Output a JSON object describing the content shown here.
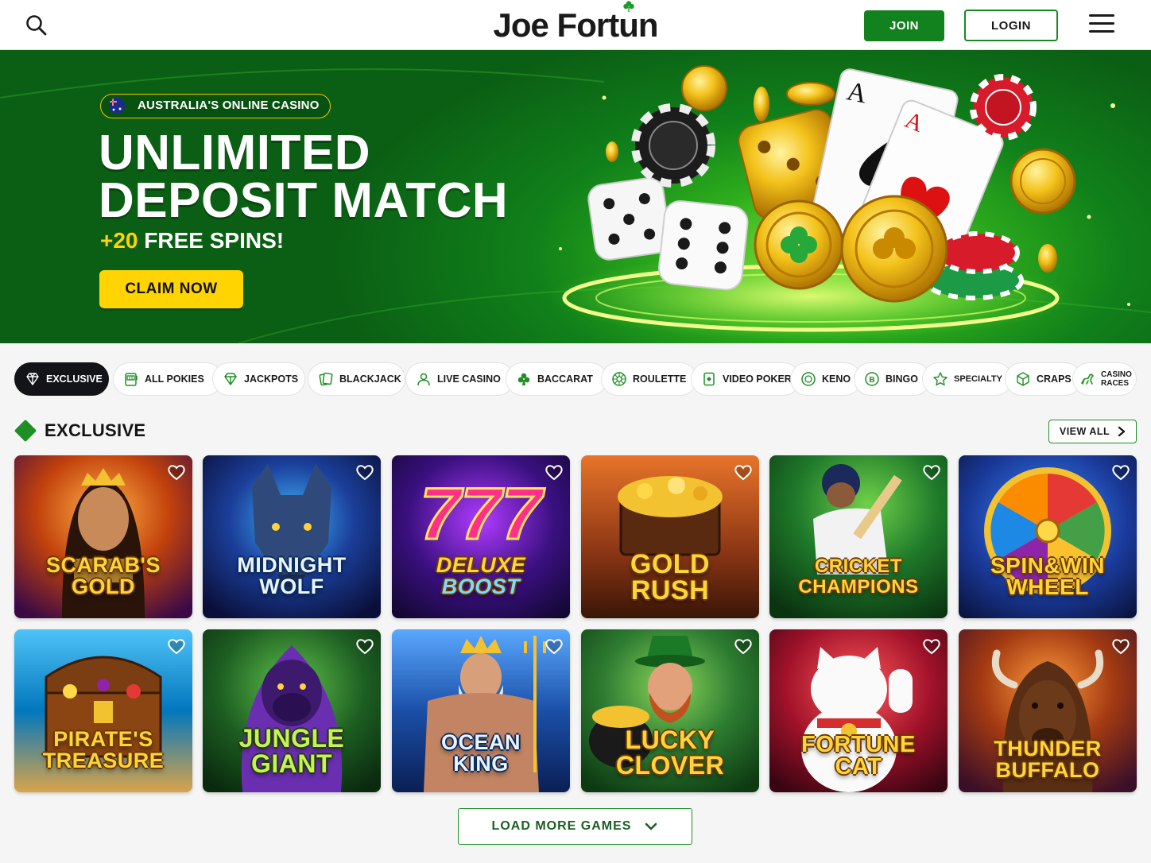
{
  "header": {
    "logo_text_pre": "Joe Fort",
    "logo_text_u": "u",
    "logo_text_post": "n",
    "join_label": "JOIN",
    "login_label": "LOGIN"
  },
  "hero": {
    "pill_text": "AUSTRALIA'S ONLINE CASINO",
    "headline_line1": "UNLIMITED",
    "headline_line2": "DEPOSIT MATCH",
    "sub_highlight": "+20",
    "sub_text": " FREE SPINS!",
    "cta_label": "CLAIM NOW"
  },
  "categories": [
    {
      "label": "EXCLUSIVE",
      "icon": "diamond-icon",
      "active": true
    },
    {
      "label": "ALL POKIES",
      "icon": "slot-machine-icon"
    },
    {
      "label": "JACKPOTS",
      "icon": "gem-icon"
    },
    {
      "label": "BLACKJACK",
      "icon": "cards-icon"
    },
    {
      "label": "LIVE CASINO",
      "icon": "dealer-icon"
    },
    {
      "label": "BACCARAT",
      "icon": "club-icon"
    },
    {
      "label": "ROULETTE",
      "icon": "roulette-icon"
    },
    {
      "label": "VIDEO POKER",
      "icon": "poker-card-icon"
    },
    {
      "label": "KENO",
      "icon": "keno-ball-icon"
    },
    {
      "label": "BINGO",
      "icon": "bingo-ball-icon"
    },
    {
      "label": "SPECIALTY",
      "icon": "star-icon"
    },
    {
      "label": "CRAPS",
      "icon": "dice-icon"
    },
    {
      "label_line1": "CASINO",
      "label_line2": "RACES",
      "icon": "horse-icon"
    }
  ],
  "section": {
    "title": "EXCLUSIVE",
    "view_all_label": "VIEW ALL"
  },
  "games": [
    {
      "line1": "SCARAB'S",
      "line2": "GOLD"
    },
    {
      "line1": "MIDNIGHT",
      "line2": "WOLF"
    },
    {
      "line1": "DELUXE",
      "line2": "BOOST",
      "extra": "777"
    },
    {
      "line1": "GOLD",
      "line2": "RUSH"
    },
    {
      "line1": "CRICKET",
      "line2": "CHAMPIONS"
    },
    {
      "line1": "SPIN&WIN",
      "line2": "WHEEL"
    },
    {
      "line1": "PIRATE'S",
      "line2": "TREASURE"
    },
    {
      "line1": "JUNGLE",
      "line2": "GIANT"
    },
    {
      "line1": "OCEAN",
      "line2": "KING"
    },
    {
      "line1": "LUCKY",
      "line2": "CLOVER"
    },
    {
      "line1": "FORTUNE",
      "line2": "CAT"
    },
    {
      "line1": "THUNDER",
      "line2": "BUFFALO"
    }
  ],
  "load_more_label": "LOAD MORE GAMES",
  "colors": {
    "brand_green": "#1f8f25",
    "cta_yellow": "#ffd400",
    "active_tab": "#121417"
  }
}
